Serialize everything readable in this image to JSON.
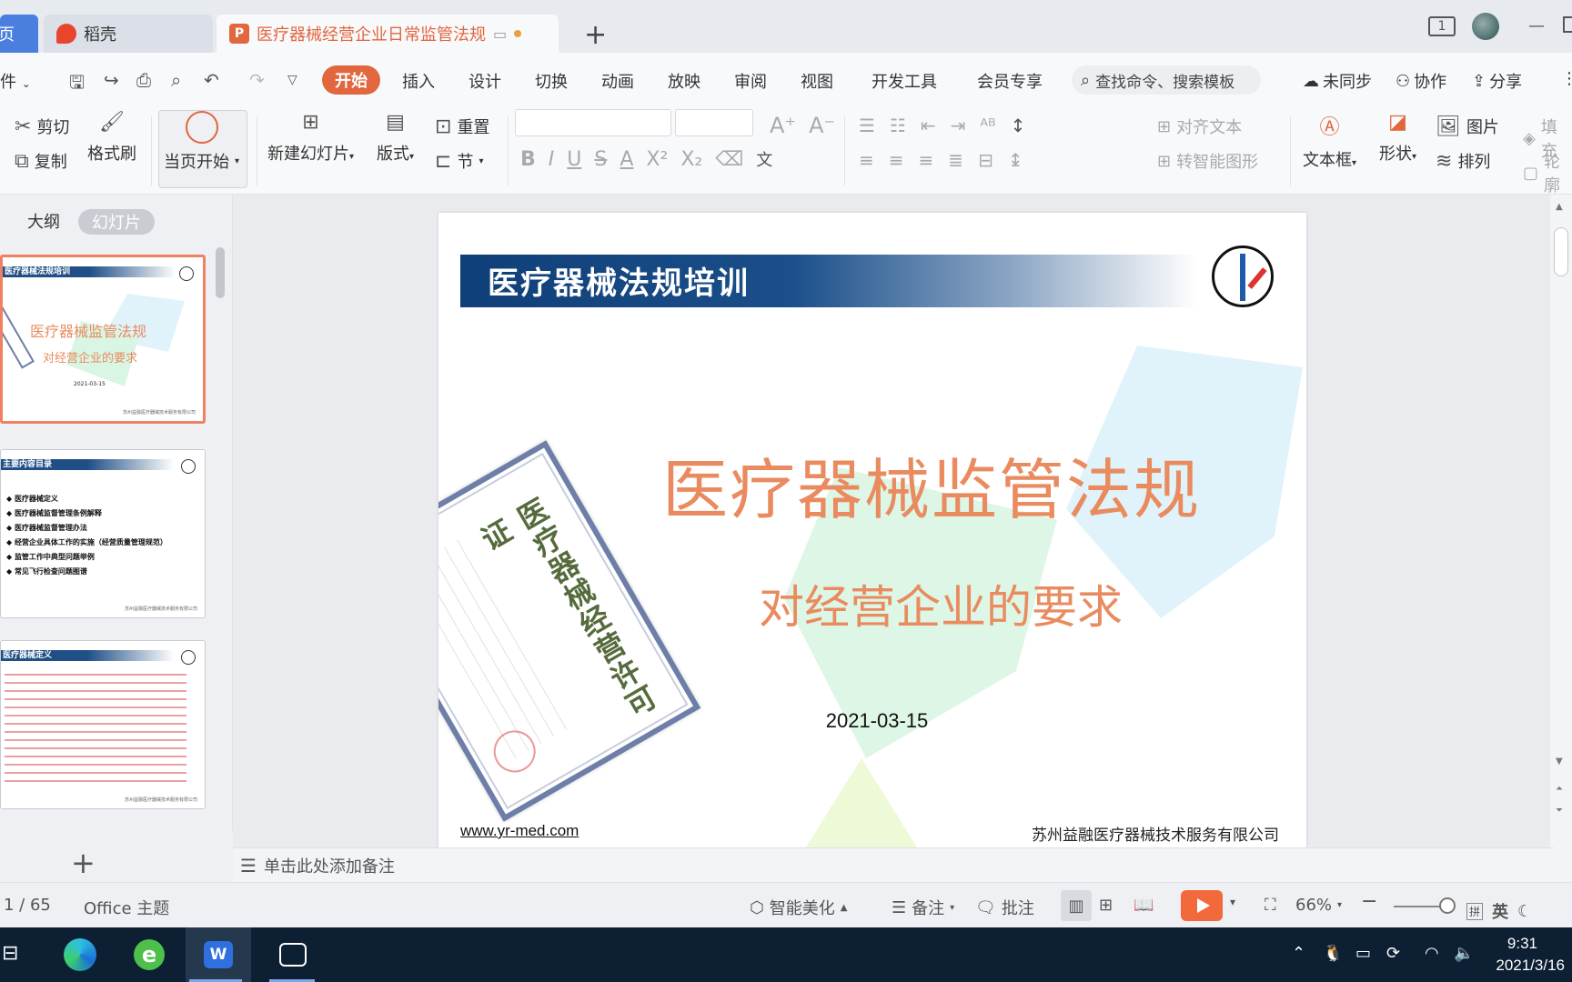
{
  "tabs": {
    "home_label": "页",
    "docer_label": "稻壳",
    "doc_label": "医疗器械经营企业日常监管法规",
    "add_label": "+"
  },
  "titlebar": {
    "page_badge": "1"
  },
  "menubar": {
    "file_label": "件",
    "items": [
      "开始",
      "插入",
      "设计",
      "切换",
      "动画",
      "放映",
      "审阅",
      "视图",
      "开发工具",
      "会员专享"
    ],
    "search_placeholder": "查找命令、搜索模板",
    "sync_label": "未同步",
    "collab_label": "协作",
    "share_label": "分享"
  },
  "ribbon": {
    "cut": "剪切",
    "copy": "复制",
    "format_painter": "格式刷",
    "from_current": "当页开始",
    "new_slide": "新建幻灯片",
    "layout": "版式",
    "reset": "重置",
    "section": "节",
    "align_text": "对齐文本",
    "smart_graphic": "转智能图形",
    "textbox": "文本框",
    "shape": "形状",
    "picture": "图片",
    "arrange": "排列",
    "fill": "填充",
    "outline": "轮廓"
  },
  "leftpanel": {
    "outline_tab": "大纲",
    "slides_tab": "幻灯片",
    "thumb1": {
      "head": "医疗器械法规培训",
      "title": "医疗器械监管法规",
      "sub": "对经营企业的要求",
      "date": "2021-03-15"
    },
    "thumb2": {
      "head": "主要内容目录",
      "items": [
        "医疗器械定义",
        "医疗器械监督管理条例解释",
        "医疗器械监督管理办法",
        "经营企业具体工作的实施（经营质量管理规范）",
        "监管工作中典型问题举例",
        "常见飞行检查问题图谱"
      ]
    },
    "thumb3": {
      "head": "医疗器械定义"
    },
    "add_label": "+"
  },
  "slide": {
    "band_title": "医疗器械法规培训",
    "title": "医疗器械监管法规",
    "subtitle": "对经营企业的要求",
    "date": "2021-03-15",
    "url": "www.yr-med.com",
    "company": "苏州益融医疗器械技术服务有限公司",
    "cert_title": "医疗器械经营许可证"
  },
  "notes": {
    "placeholder": "单击此处添加备注"
  },
  "status": {
    "page": "1 / 65",
    "theme": "Office 主题",
    "beautify": "智能美化",
    "notes": "备注",
    "comment": "批注",
    "zoom": "66%",
    "ime": "英"
  },
  "taskbar": {
    "time": "9:31",
    "date": "2021/3/16"
  }
}
